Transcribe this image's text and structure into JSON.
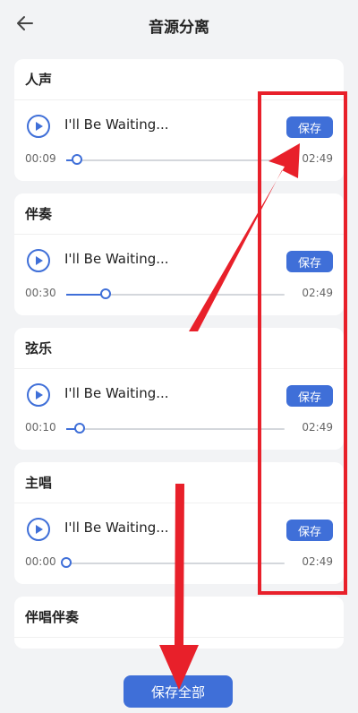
{
  "header": {
    "title": "音源分离",
    "back_icon": "arrow-left-icon"
  },
  "tracks": [
    {
      "label": "人声",
      "track_name": "I'll Be Waiting...",
      "current_time": "00:09",
      "total_time": "02:49",
      "save_label": "保存",
      "progress": 0.05
    },
    {
      "label": "伴奏",
      "track_name": "I'll Be Waiting...",
      "current_time": "00:30",
      "total_time": "02:49",
      "save_label": "保存",
      "progress": 0.18
    },
    {
      "label": "弦乐",
      "track_name": "I'll Be Waiting...",
      "current_time": "00:10",
      "total_time": "02:49",
      "save_label": "保存",
      "progress": 0.06
    },
    {
      "label": "主唱",
      "track_name": "I'll Be Waiting...",
      "current_time": "00:00",
      "total_time": "02:49",
      "save_label": "保存",
      "progress": 0.0
    }
  ],
  "partial_track": {
    "label": "伴唱伴奏"
  },
  "footer": {
    "save_all_label": "保存全部"
  },
  "colors": {
    "accent": "#3f6fd8",
    "annotation_red": "#e8202a",
    "background": "#f2f3f5"
  }
}
